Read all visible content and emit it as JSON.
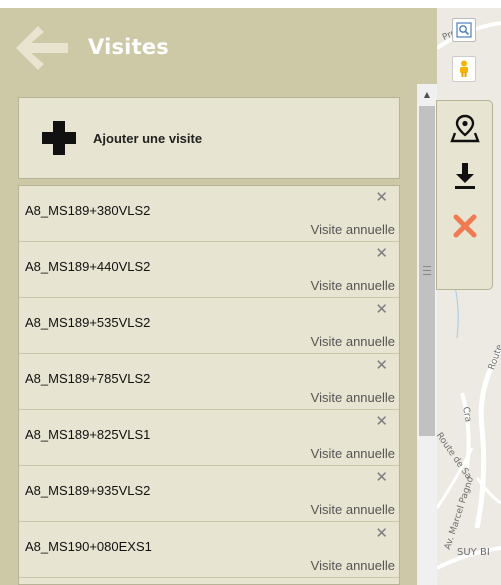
{
  "header": {
    "title": "Visites",
    "back_icon": "arrow-left-icon"
  },
  "add_button": {
    "label": "Ajouter une visite",
    "icon": "plus-icon"
  },
  "visits": [
    {
      "code": "A8_MS189+380VLS2",
      "type": "Visite annuelle"
    },
    {
      "code": "A8_MS189+440VLS2",
      "type": "Visite annuelle"
    },
    {
      "code": "A8_MS189+535VLS2",
      "type": "Visite annuelle"
    },
    {
      "code": "A8_MS189+785VLS2",
      "type": "Visite annuelle"
    },
    {
      "code": "A8_MS189+825VLS1",
      "type": "Visite annuelle"
    },
    {
      "code": "A8_MS189+935VLS2",
      "type": "Visite annuelle"
    },
    {
      "code": "A8_MS190+080EXS1",
      "type": "Visite annuelle"
    }
  ],
  "row_close_glyph": "✕",
  "toolbar": {
    "icons": [
      "map-marker-icon",
      "download-icon",
      "close-icon"
    ]
  },
  "map": {
    "labels": [
      "Prov",
      "Route",
      "Cra",
      "Route de Sa",
      "Av. Marcel Pagno",
      "SUY BI"
    ]
  },
  "colors": {
    "panel": "#cdc8a6",
    "card": "#e7e4d1",
    "accent_red": "#f07a52",
    "map": "#eceae3"
  }
}
